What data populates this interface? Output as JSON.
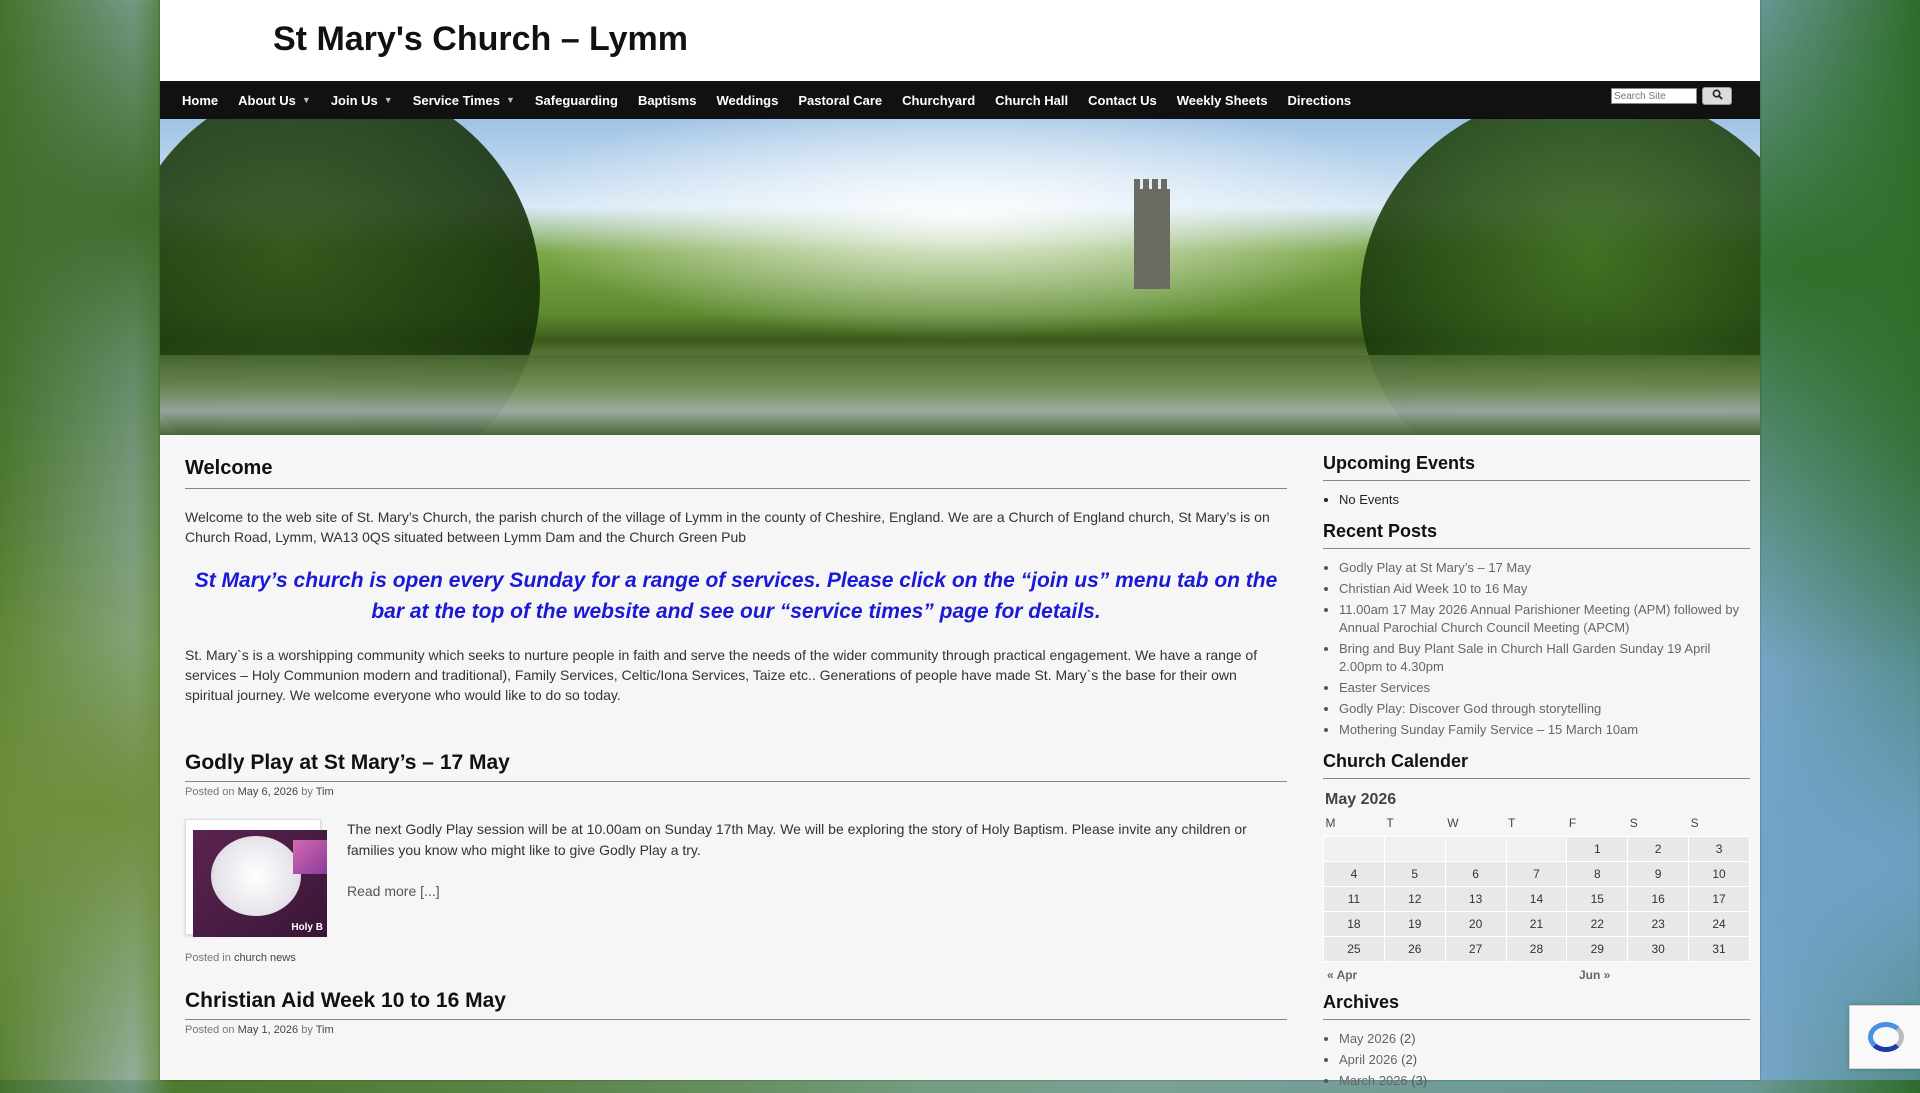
{
  "site": {
    "title": "St Mary's Church – Lymm"
  },
  "nav": {
    "items": [
      {
        "label": "Home"
      },
      {
        "label": "About Us",
        "dropdown": true
      },
      {
        "label": "Join Us",
        "dropdown": true
      },
      {
        "label": "Service Times",
        "dropdown": true
      },
      {
        "label": "Safeguarding"
      },
      {
        "label": "Baptisms"
      },
      {
        "label": "Weddings"
      },
      {
        "label": "Pastoral Care"
      },
      {
        "label": "Churchyard"
      },
      {
        "label": "Church Hall"
      },
      {
        "label": "Contact Us"
      },
      {
        "label": "Weekly Sheets"
      },
      {
        "label": "Directions"
      }
    ],
    "search_placeholder": "Search Site",
    "search_icon": "search-icon"
  },
  "welcome": {
    "title": "Welcome",
    "intro": "Welcome to the web site of St. Mary’s Church, the parish church of the village of Lymm in the county of Cheshire, England. We are a Church of England church, St Mary’s is on Church Road, Lymm, WA13 0QS situated between Lymm Dam and the Church Green Pub",
    "callout": "St Mary’s church is open every Sunday for a range of services. Please click on the “join us” menu tab on the bar at the top of the website and see our “service times” page for details.",
    "body": "St. Mary`s is a worshipping community which seeks to nurture people in faith and serve the needs of the wider community through practical engagement. We have a range of services – Holy Communion modern and traditional), Family Services, Celtic/Iona Services, Taize etc.. Generations of people have made St. Mary`s the base for their own spiritual journey. We welcome everyone who would like to do so today."
  },
  "posts": [
    {
      "title": "Godly Play at St Mary’s – 17 May",
      "posted_on_label": "Posted on",
      "date": "May 6, 2026",
      "by_label": "by",
      "author": "Tim",
      "thumb_text": "Holy B",
      "excerpt": "The next Godly Play session will be at 10.00am on Sunday 17th May. We will be exploring the story of Holy Baptism. Please invite any children or families you know who might like to give Godly Play a try.",
      "read_more": "Read more [...]",
      "posted_in_label": "Posted in",
      "category": "church news"
    },
    {
      "title": "Christian Aid Week 10 to 16 May",
      "posted_on_label": "Posted on",
      "date": "May 1, 2026",
      "by_label": "by",
      "author": "Tim"
    }
  ],
  "sidebar": {
    "upcoming_title": "Upcoming Events",
    "upcoming_items": [
      "No Events"
    ],
    "recent_title": "Recent Posts",
    "recent_items": [
      "Godly Play at St Mary’s – 17 May",
      "Christian Aid Week 10 to 16 May",
      "11.00am 17 May 2026 Annual Parishioner Meeting (APM) followed by Annual Parochial Church Council Meeting (APCM)",
      "Bring and Buy Plant Sale in Church Hall Garden Sunday 19 April 2.00pm to 4.30pm",
      "Easter Services",
      "Godly Play: Discover God through storytelling",
      "Mothering Sunday Family Service – 15 March 10am"
    ],
    "calendar_title": "Church Calender",
    "calendar": {
      "caption": "May 2026",
      "weekdays": [
        "M",
        "T",
        "W",
        "T",
        "F",
        "S",
        "S"
      ],
      "weeks": [
        [
          "",
          "",
          "",
          "",
          "1",
          "2",
          "3"
        ],
        [
          "4",
          "5",
          "6",
          "7",
          "8",
          "9",
          "10"
        ],
        [
          "11",
          "12",
          "13",
          "14",
          "15",
          "16",
          "17"
        ],
        [
          "18",
          "19",
          "20",
          "21",
          "22",
          "23",
          "24"
        ],
        [
          "25",
          "26",
          "27",
          "28",
          "29",
          "30",
          "31"
        ]
      ],
      "prev": "« Apr",
      "next": "Jun »"
    },
    "archives_title": "Archives",
    "archives": [
      {
        "month": "May 2026",
        "count": "(2)"
      },
      {
        "month": "April 2026",
        "count": "(2)"
      },
      {
        "month": "March 2026",
        "count": "(3)"
      }
    ]
  },
  "colors": {
    "nav_bg": "#111111",
    "callout": "#1a1ad6",
    "page_bg": "#f6f6f6"
  }
}
